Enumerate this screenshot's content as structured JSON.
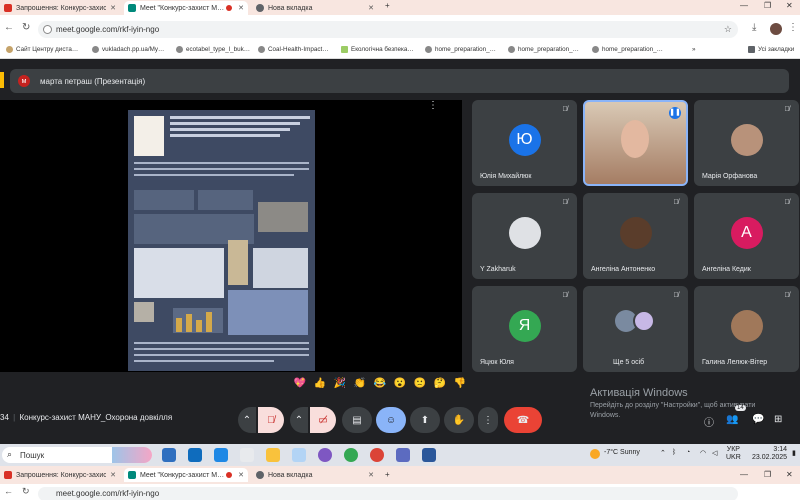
{
  "browser": {
    "tabs": [
      {
        "label": "Запрошення: Конкурс-захист М…",
        "color": "#d93025"
      },
      {
        "label": "Meet \"Конкурс-захист М…",
        "color": "#00897b"
      },
      {
        "label": "Нова вкладка",
        "color": "#5f6368"
      }
    ],
    "url": "meet.google.com/rkf-iyin-ngo",
    "bookmarks": [
      "Сайт Центру дистa…",
      "vukladach.pp.ua/My…",
      "ecotabel_type_l_buk…",
      "Coal-Health-Impact…",
      "Екологічна безпека…",
      "home_preparation_…",
      "home_preparation_…",
      "home_preparation_…"
    ],
    "all_bookmarks": "Усі закладки"
  },
  "meet": {
    "presenter_avatar": "м",
    "presenter_label": "марта петраш (Презентація)",
    "meeting_code_prefix": "34",
    "meeting_title": "Конкурс-захист МАНУ_Охорона довкілля",
    "participants": [
      {
        "name": "Юлія Михайлюк",
        "avatar": "Ю",
        "color": "#1a73e8",
        "kind": "letter"
      },
      {
        "name": "",
        "avatar": "",
        "color": "#c9a084",
        "kind": "video"
      },
      {
        "name": "Марія Орфанова",
        "avatar": "",
        "color": "#b8927a",
        "kind": "photo"
      },
      {
        "name": "Y Zakharuk",
        "avatar": "",
        "color": "#dfe1e5",
        "kind": "photo"
      },
      {
        "name": "Ангеліна Антоненко",
        "avatar": "",
        "color": "#5a3d2b",
        "kind": "photo"
      },
      {
        "name": "Ангеліна Кедик",
        "avatar": "А",
        "color": "#d81b60",
        "kind": "letter"
      },
      {
        "name": "Яцюк Юля",
        "avatar": "Я",
        "color": "#34a853",
        "kind": "letter"
      },
      {
        "name": "Ще 5 осіб",
        "avatar": "",
        "color": "#7a8aa0",
        "kind": "group"
      },
      {
        "name": "Галина Лелюк-Вітер",
        "avatar": "",
        "color": "#a0785a",
        "kind": "photo"
      }
    ],
    "reactions": [
      "💖",
      "👍",
      "🎉",
      "👏",
      "😂",
      "😮",
      "🙁",
      "🤔",
      "👎"
    ],
    "activation_title": "Активація Windows",
    "activation_sub": "Перейдіть до розділу \"Настройки\", щоб активувати Windows.",
    "people_count": "14"
  },
  "taskbar": {
    "search": "Пошук",
    "weather": "-7°C  Sunny",
    "lang": "УКР",
    "lang2": "UKR",
    "time": "3:14",
    "date": "23.02.2025"
  }
}
